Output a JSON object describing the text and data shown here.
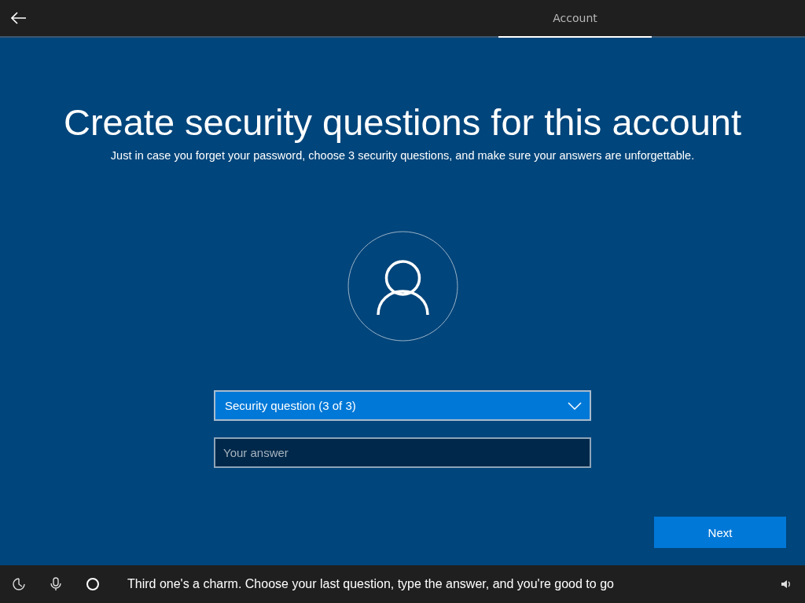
{
  "tabs": [
    {
      "label": "Account",
      "selected": true
    }
  ],
  "title": "Create security questions for this account",
  "subtitle": "Just in case you forget your password, choose 3 security questions, and make sure your answers are unforgettable.",
  "question_dropdown": {
    "value": "Security question (3 of 3)"
  },
  "answer_field": {
    "placeholder": "Your answer"
  },
  "buttons": [
    "Next"
  ],
  "status_bar": {
    "message": "Third one's a charm. Choose your last question, type the answer, and you're good to go"
  }
}
